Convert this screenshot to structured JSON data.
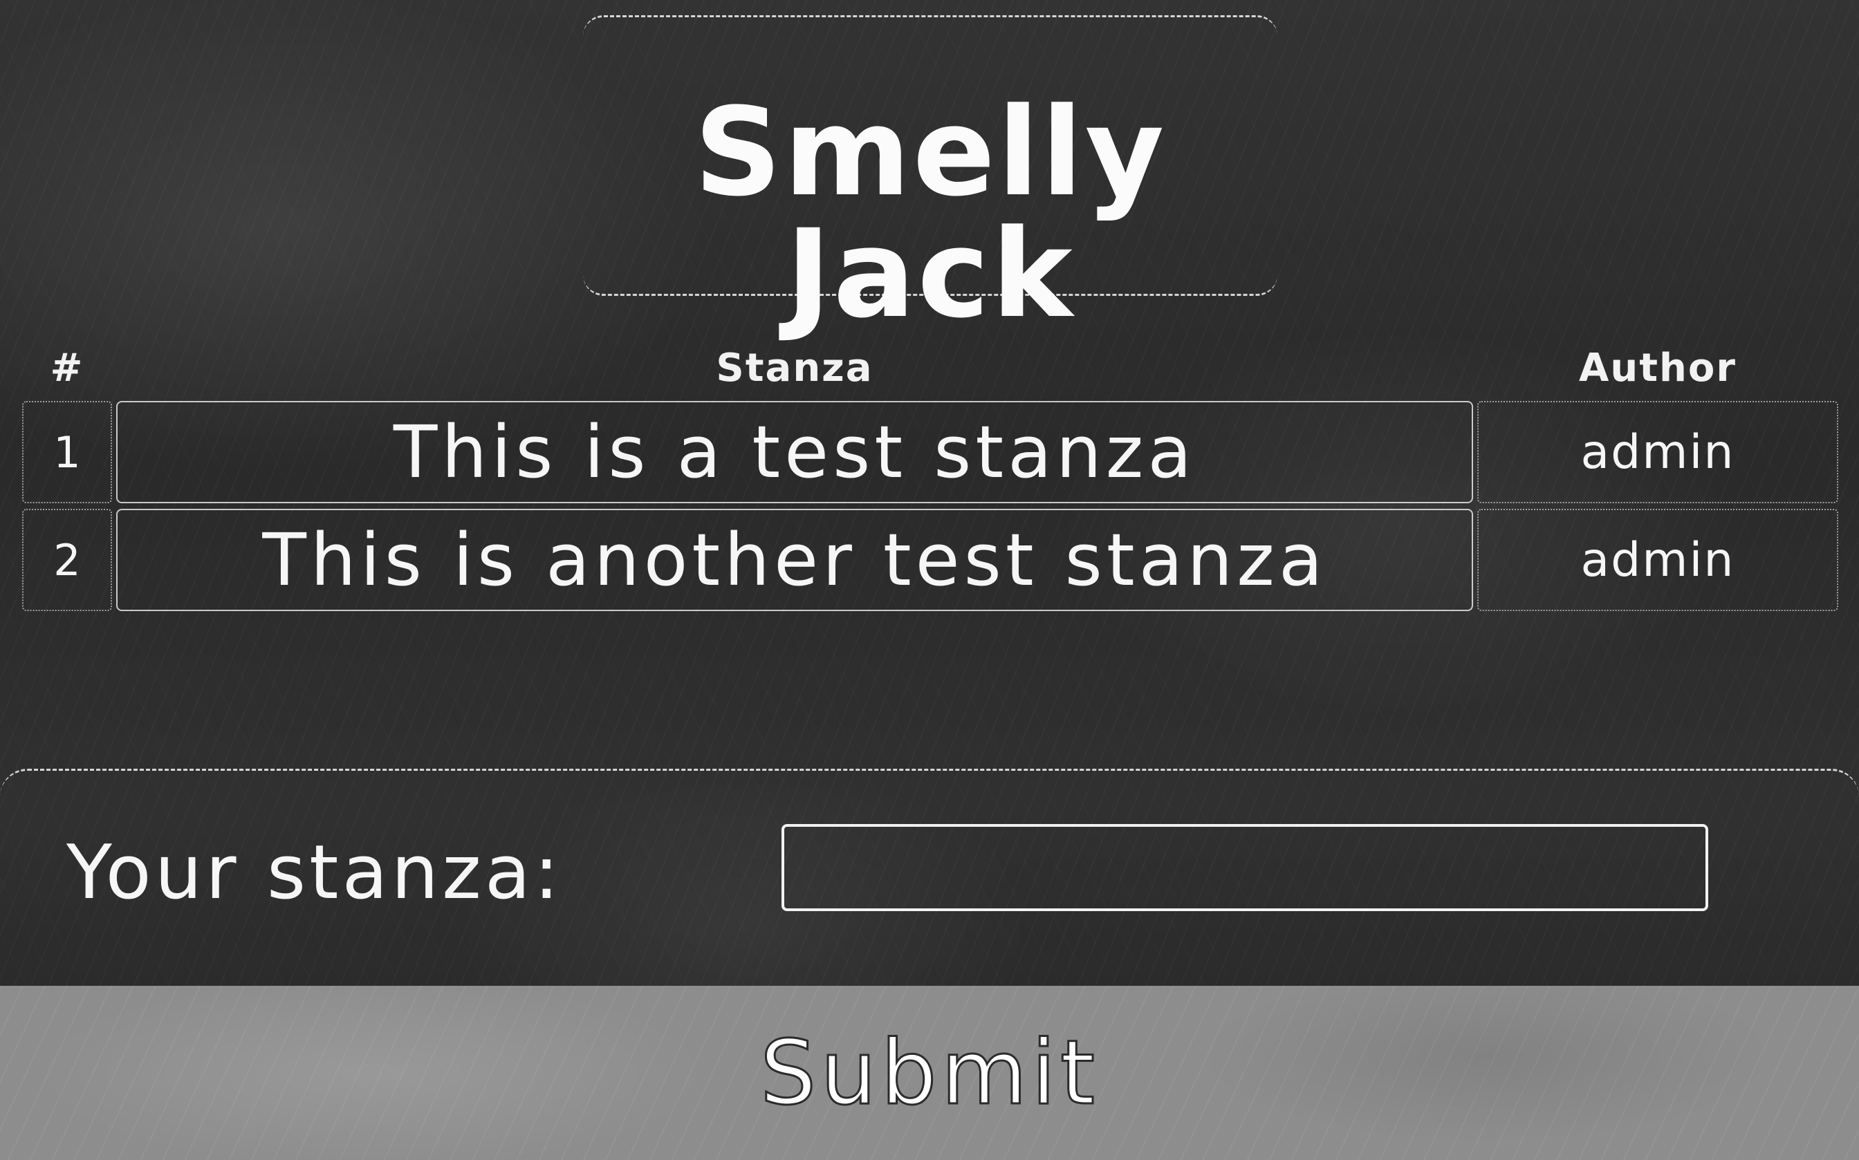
{
  "header": {
    "title": "Smelly Jack"
  },
  "table": {
    "columns": [
      "#",
      "Stanza",
      "Author"
    ],
    "rows": [
      {
        "num": "1",
        "stanza": "This is a test stanza",
        "author": "admin"
      },
      {
        "num": "2",
        "stanza": "This is another test stanza",
        "author": "admin"
      }
    ]
  },
  "form": {
    "label": "Your stanza:",
    "input_value": "",
    "input_placeholder": "",
    "submit_label": "Submit"
  },
  "colors": {
    "background": "#2f2f2f",
    "text": "#f4f4f4",
    "submit_bar": "#8d8d8d"
  }
}
